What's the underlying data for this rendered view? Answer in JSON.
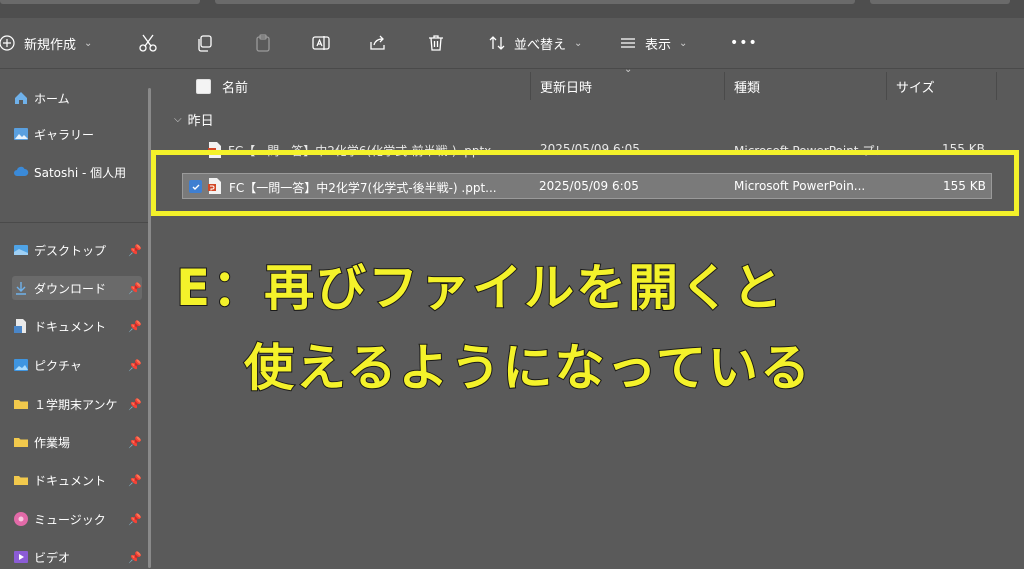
{
  "toolbar": {
    "new_label": "新規作成",
    "sort_label": "並べ替え",
    "view_label": "表示",
    "more_label": "•••"
  },
  "columns": {
    "name": "名前",
    "modified": "更新日時",
    "type": "種類",
    "size": "サイズ"
  },
  "group": {
    "label": "昨日"
  },
  "sidebar": {
    "items": [
      {
        "label": "ホーム",
        "icon": "home-icon"
      },
      {
        "label": "ギャラリー",
        "icon": "gallery-icon"
      },
      {
        "label": "Satoshi - 個人用",
        "icon": "cloud-icon"
      },
      {
        "label": "デスクトップ",
        "icon": "desktop-icon"
      },
      {
        "label": "ダウンロード",
        "icon": "download-icon"
      },
      {
        "label": "ドキュメント",
        "icon": "documents-icon"
      },
      {
        "label": "ピクチャ",
        "icon": "pictures-icon"
      },
      {
        "label": "１学期末アンケ",
        "icon": "folder-icon"
      },
      {
        "label": "作業場",
        "icon": "folder-icon"
      },
      {
        "label": "ドキュメント",
        "icon": "folder-icon"
      },
      {
        "label": "ミュージック",
        "icon": "music-icon"
      },
      {
        "label": "ビデオ",
        "icon": "video-icon"
      }
    ]
  },
  "files": {
    "ghost": {
      "name": "FC【一問一答】中2化学6(化学式-前半戦-) .pptx",
      "modified": "2025/05/09 6:05",
      "type": "Microsoft PowerPoint プレゼンテーション",
      "size": "155 KB"
    },
    "selected": {
      "name": "FC【一問一答】中2化学7(化学式-後半戦-) .ppt...",
      "modified": "2025/05/09 6:05",
      "type": "Microsoft PowerPoin...",
      "size": "155 KB"
    }
  },
  "annotation": {
    "line1": "E：再びファイルを開くと",
    "line2": "使えるようになっている"
  },
  "colors": {
    "highlight": "#f4f22a",
    "background": "#5a5a5a",
    "selection": "#7a7a7a",
    "checkbox_blue": "#3f7fd1",
    "ppt_red": "#d24726"
  }
}
